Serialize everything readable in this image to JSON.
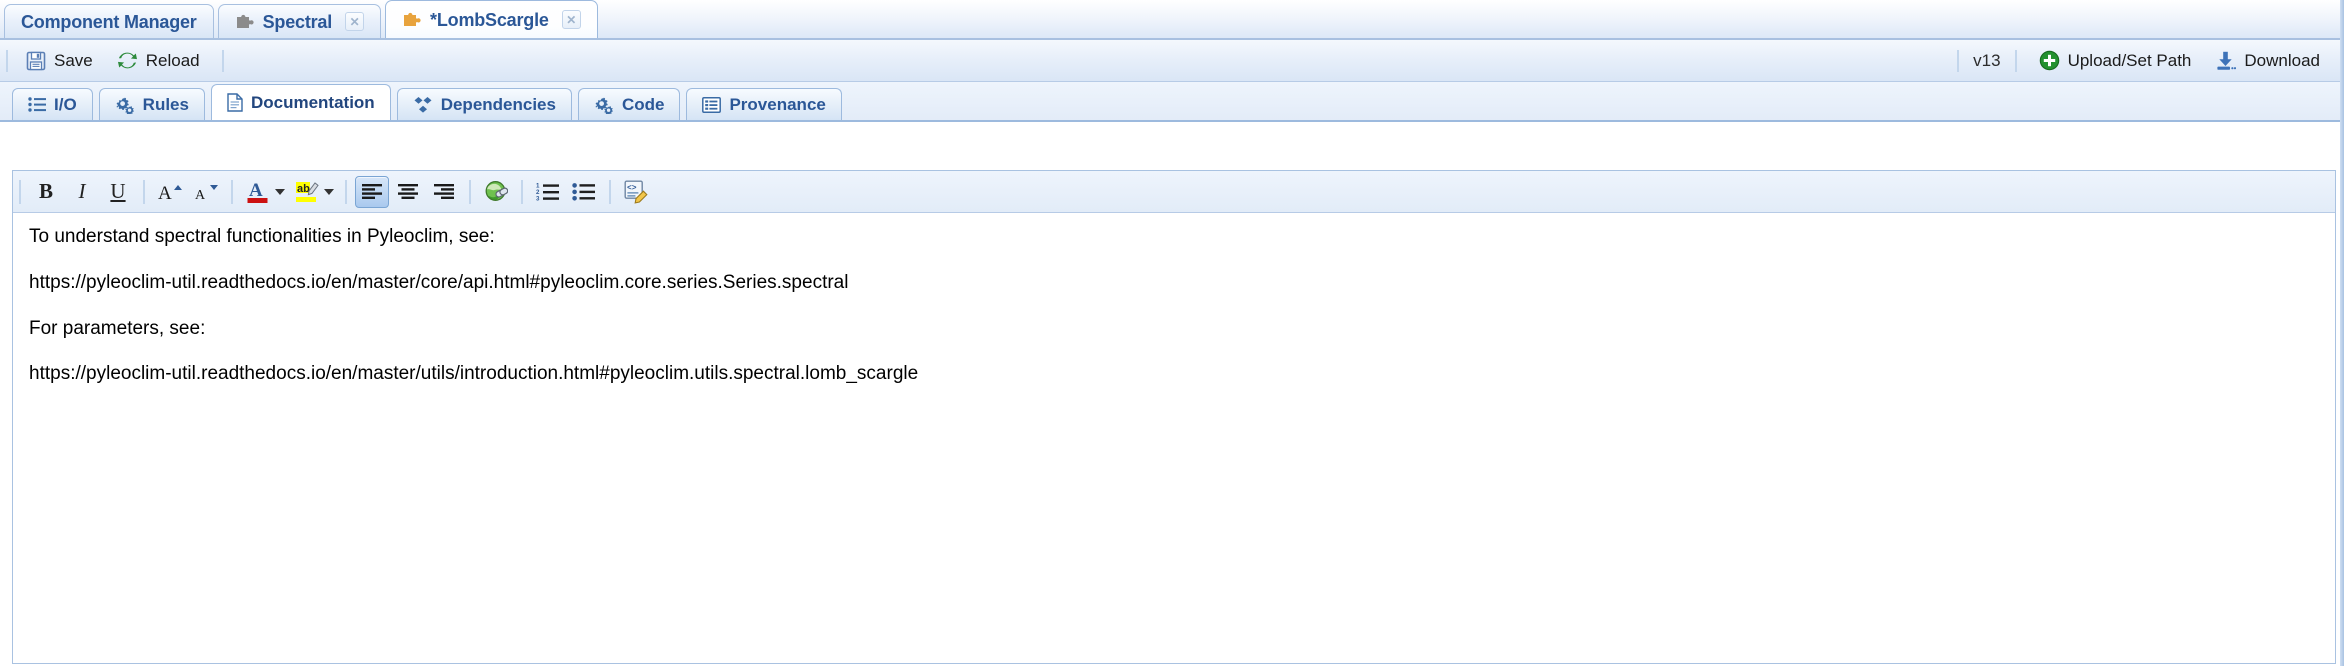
{
  "window_tabs": [
    {
      "label": "Component Manager",
      "icon": "none",
      "closable": false,
      "active": false,
      "modified": false
    },
    {
      "label": "Spectral",
      "icon": "puzzle-gray",
      "closable": true,
      "active": false,
      "modified": false
    },
    {
      "label": "*LombScargle",
      "icon": "puzzle-orange",
      "closable": true,
      "active": true,
      "modified": true
    }
  ],
  "close_glyph": "✕",
  "action_toolbar": {
    "left_buttons": [
      {
        "label": "Save",
        "icon": "floppy-disk-icon"
      },
      {
        "label": "Reload",
        "icon": "refresh-icon"
      }
    ],
    "version_label": "v13",
    "right_buttons": [
      {
        "label": "Upload/Set Path",
        "icon": "plus-circle-icon"
      },
      {
        "label": "Download",
        "icon": "download-icon"
      }
    ]
  },
  "inner_tabs": [
    {
      "label": "I/O",
      "icon": "list-icon",
      "active": false
    },
    {
      "label": "Rules",
      "icon": "gears-icon",
      "active": false
    },
    {
      "label": "Documentation",
      "icon": "document-icon",
      "active": true
    },
    {
      "label": "Dependencies",
      "icon": "diamonds-icon",
      "active": false
    },
    {
      "label": "Code",
      "icon": "gears-icon",
      "active": false
    },
    {
      "label": "Provenance",
      "icon": "table-list-icon",
      "active": false
    }
  ],
  "editor_toolbar": {
    "bold_label": "B",
    "italic_label": "I",
    "underline_label": "U",
    "buttons": [
      {
        "name": "bold-button",
        "title": "Bold"
      },
      {
        "name": "italic-button",
        "title": "Italic"
      },
      {
        "name": "underline-button",
        "title": "Underline"
      },
      {
        "name": "increase-font-button",
        "title": "Increase Font Size"
      },
      {
        "name": "decrease-font-button",
        "title": "Decrease Font Size"
      },
      {
        "name": "font-color-button",
        "title": "Font Color"
      },
      {
        "name": "highlight-color-button",
        "title": "Text Highlight Color"
      },
      {
        "name": "align-left-button",
        "title": "Align Left"
      },
      {
        "name": "align-center-button",
        "title": "Align Center"
      },
      {
        "name": "align-right-button",
        "title": "Align Right"
      },
      {
        "name": "insert-link-button",
        "title": "Insert Link"
      },
      {
        "name": "numbered-list-button",
        "title": "Numbered List"
      },
      {
        "name": "bullet-list-button",
        "title": "Bulleted List"
      },
      {
        "name": "edit-source-button",
        "title": "Edit HTML Source"
      }
    ],
    "active_button": "align-left-button",
    "font_color": "#cc1111",
    "highlight_color": "#ffff00"
  },
  "document": {
    "paragraphs": [
      "To understand spectral functionalities in Pyleoclim, see:",
      "https://pyleoclim-util.readthedocs.io/en/master/core/api.html#pyleoclim.core.series.Series.spectral",
      "For parameters, see:",
      "https://pyleoclim-util.readthedocs.io/en/master/utils/introduction.html#pyleoclim.utils.spectral.lomb_scargle"
    ]
  },
  "colors": {
    "accent_blue": "#2b5797",
    "border_blue": "#a8c0e0",
    "toolbar_bg": "#e6eef9",
    "save_icon": "#5b7fb5",
    "reload_icon": "#2e8b3d",
    "upload_icon": "#23912f",
    "download_icon": "#3d72b8",
    "puzzle_gray": "#8b8b8b",
    "puzzle_orange": "#e8a33d"
  }
}
